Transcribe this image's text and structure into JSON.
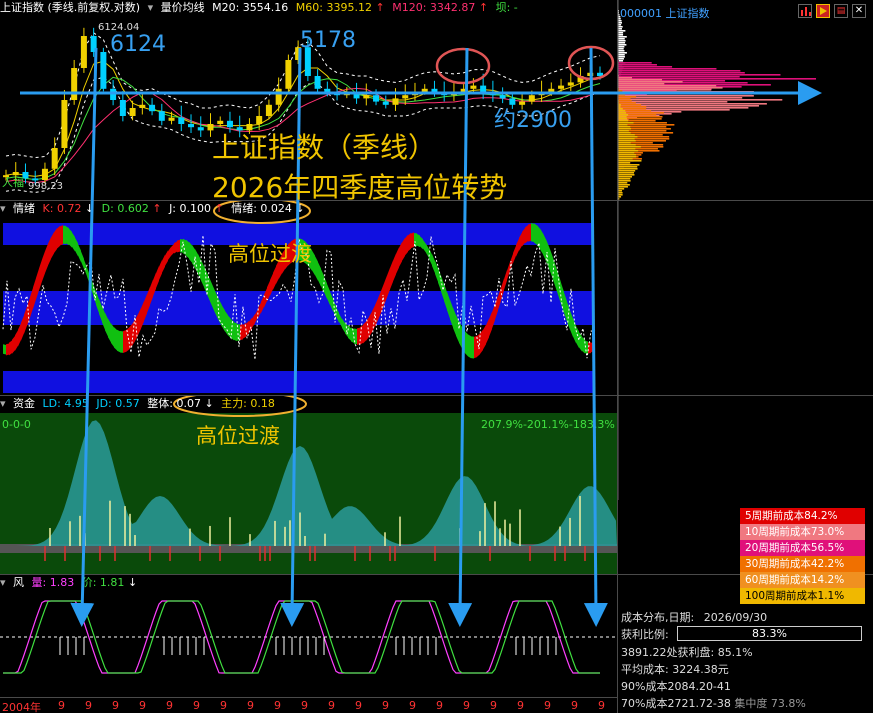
{
  "main_header": {
    "title": "上证指数 (季线.前复权.对数)",
    "indicator": "量价均线",
    "ma20": "M20: 3554.16",
    "ma60": "M60: 3395.12",
    "ma120": "M120: 3342.87",
    "ba": "坝: -",
    "label_6124": "6124.04",
    "label_998": "998.23",
    "left_tag": "人福"
  },
  "annotations": {
    "peak1": "6124",
    "peak2": "5178",
    "support": "约2900",
    "title_line1": "上证指数（季线）",
    "title_line2": "2026年四季度高位转势",
    "transition1": "高位过渡",
    "transition2": "高位过渡"
  },
  "emotion_header": {
    "name": "情绪",
    "k": "K: 0.72",
    "d": "D: 0.602",
    "j": "J: 0.100",
    "emotion": "情绪: 0.024"
  },
  "fund_header": {
    "name": "资金",
    "ld": "LD: 4.95",
    "jd": "JD: 0.57",
    "overall": "整体: 0.07",
    "main": "主力: 0.18",
    "left_tag": "0-0-0",
    "right_tag": "207.9%-201.1%-183.3%"
  },
  "wind_header": {
    "name": "风",
    "vol": "量: 1.83",
    "price": "价: 1.81"
  },
  "xaxis": {
    "start": "2004年",
    "ticks": [
      "9",
      "9",
      "9",
      "9",
      "9",
      "9",
      "9",
      "9",
      "9",
      "9",
      "9",
      "9",
      "9",
      "9",
      "9",
      "9",
      "9",
      "9",
      "9",
      "9",
      "9",
      "9"
    ]
  },
  "side_panel": {
    "code_title": "000001 上证指数",
    "legend": [
      {
        "label": "5周期前成本84.2%",
        "color": "#e00000"
      },
      {
        "label": "10周期前成本73.0%",
        "color": "#f07880"
      },
      {
        "label": "20周期前成本56.5%",
        "color": "#e0107a"
      },
      {
        "label": "30周期前成本42.2%",
        "color": "#f07000"
      },
      {
        "label": "60周期前成本14.2%",
        "color": "#f09020"
      },
      {
        "label": "100周期前成本1.1%",
        "color": "#f0b800"
      }
    ],
    "cost_date_label": "成本分布,日期:",
    "cost_date": "2026/09/30",
    "profit_label": "获利比例:",
    "profit_value": "83.3%",
    "profit_ratio": 0.833,
    "profit_curve": "3891.22处获利盘: 85.1%",
    "avg_cost": "平均成本: 3224.38元",
    "cost90": "90%成本2084.20-41",
    "cost70": "70%成本2721.72-38",
    "cost70_tail": "集中度 73.8%"
  },
  "colors": {
    "up": "#ff3333",
    "down": "#00d0ff",
    "ma20": "#ffffff",
    "ma60": "#f0d000",
    "ma120": "#ff3070",
    "arrow": "#2a9cf0",
    "circle": "#e05555",
    "oval": "#f0b030"
  }
}
